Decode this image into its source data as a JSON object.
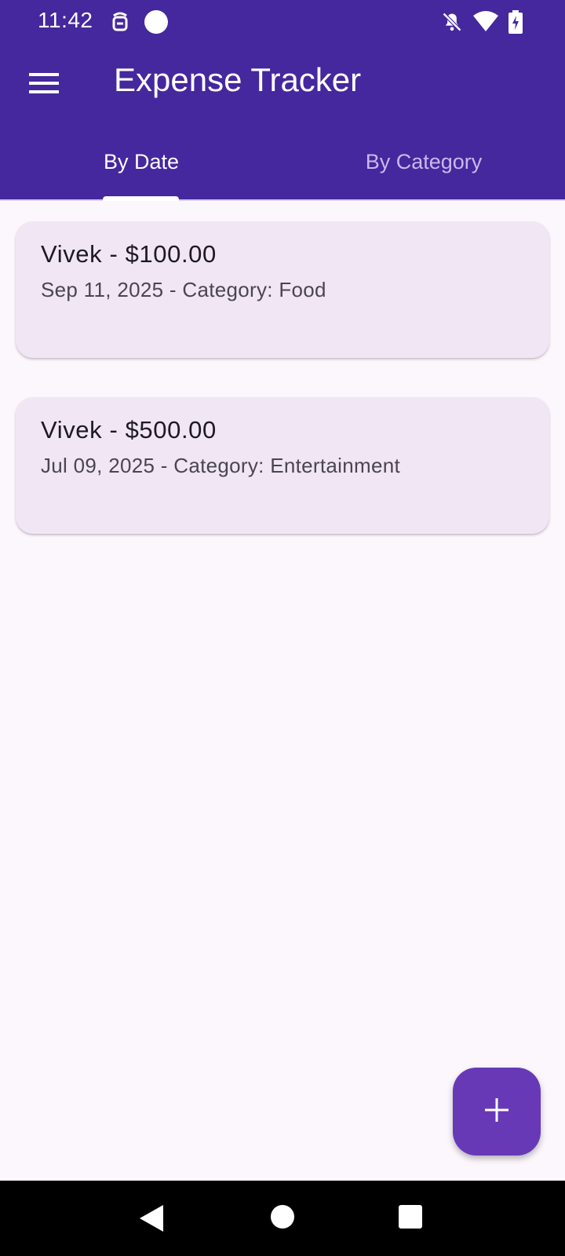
{
  "status_bar": {
    "time": "11:42",
    "icons": [
      "pinned-app-icon",
      "circle-dot-icon",
      "notifications-off-icon",
      "wifi-icon",
      "battery-charging-icon"
    ]
  },
  "app_bar": {
    "title": "Expense Tracker",
    "menu_icon": "hamburger-menu-icon"
  },
  "tabs": [
    {
      "label": "By Date",
      "selected": true
    },
    {
      "label": "By Category",
      "selected": false
    }
  ],
  "expenses": [
    {
      "title": "Vivek - $100.00",
      "subtitle": "Sep 11, 2025 - Category: Food"
    },
    {
      "title": "Vivek - $500.00",
      "subtitle": "Jul 09, 2025 - Category: Entertainment"
    }
  ],
  "fab": {
    "icon": "plus-icon"
  },
  "nav_bar": {
    "icons": [
      "back-icon",
      "home-icon",
      "recents-icon"
    ]
  },
  "colors": {
    "primary": "#45279E",
    "fab": "#6739B7",
    "card": "#F1E6F4",
    "background": "#FCF6FD"
  }
}
